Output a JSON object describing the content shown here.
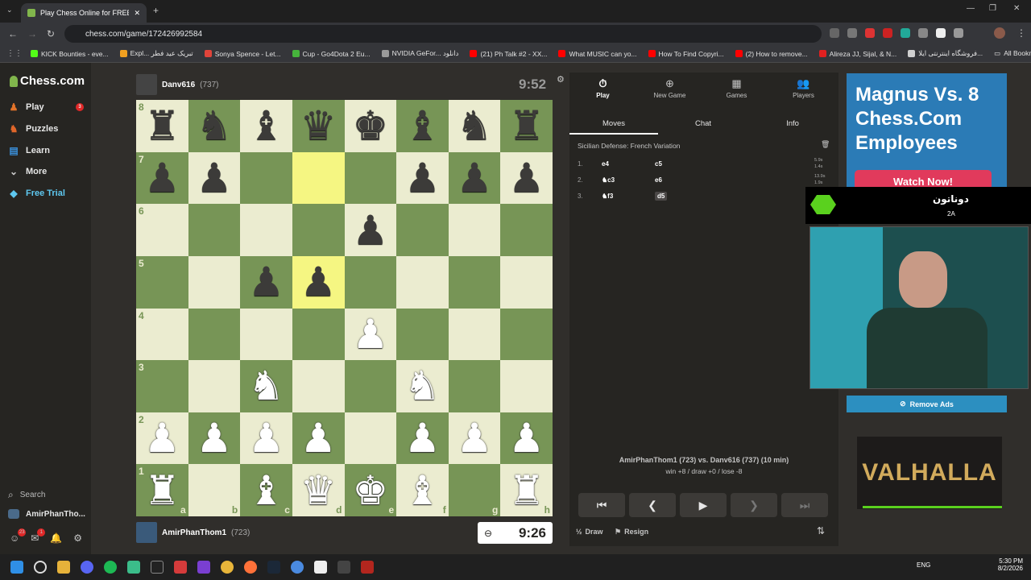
{
  "browser": {
    "tab_title": "Play Chess Online for FREE",
    "tab_close": "✕",
    "new_tab": "+",
    "url": "chess.com/game/172426992584",
    "bookmarks": [
      {
        "label": "KICK Bounties - eve...",
        "color": "#53fc18"
      },
      {
        "label": "Expl... تبریک عید فطر",
        "color": "#f0a020"
      },
      {
        "label": "Sonya Spence - Let...",
        "color": "#e0443a"
      },
      {
        "label": "Cup - Go4Dota 2 Eu...",
        "color": "#46b43c"
      },
      {
        "label": "NVIDIA GeFor... دانلود",
        "color": "#9a9a9a"
      },
      {
        "label": "(21) Ph Talk #2 - XX...",
        "color": "#ff0000"
      },
      {
        "label": "What MUSIC can yo...",
        "color": "#ff0000"
      },
      {
        "label": "How To Find Copyri...",
        "color": "#ff0000"
      },
      {
        "label": "(2) How to remove...",
        "color": "#ff0000"
      },
      {
        "label": "Alireza JJ, Sijal, & N...",
        "color": "#e02020"
      },
      {
        "label": "فروشگاه اینترنتی ایلا...",
        "color": "#d0d0d0"
      }
    ],
    "all_bookmarks": "All Bookmarks"
  },
  "sidebar": {
    "logo": "Chess.com",
    "items": [
      {
        "label": "Play",
        "color": "#e27329",
        "badge": "3"
      },
      {
        "label": "Puzzles",
        "color": "#e0662a",
        "badge": ""
      },
      {
        "label": "Learn",
        "color": "#3a8fd9",
        "badge": ""
      },
      {
        "label": "More",
        "color": "",
        "badge": ""
      },
      {
        "label": "Free Trial",
        "color": "#5ec8f0",
        "badge": ""
      }
    ],
    "search": "Search",
    "user": "AmirPhanTho...",
    "friends_badge": "23",
    "messages_badge": "1"
  },
  "game": {
    "top_player": {
      "name": "Danv616",
      "rating": "(737)",
      "clock": "9:52"
    },
    "bottom_player": {
      "name": "AmirPhanThom1",
      "rating": "(723)",
      "clock": "9:26"
    },
    "ranks": [
      "8",
      "7",
      "6",
      "5",
      "4",
      "3",
      "2",
      "1"
    ],
    "files": [
      "a",
      "b",
      "c",
      "d",
      "e",
      "f",
      "g",
      "h"
    ],
    "position": [
      "rnbqkbnr",
      "pp...ppp",
      "....p...",
      "..pp....",
      "....P...",
      "..N..N..",
      "PPPP.PPP",
      "R.BQKB.R"
    ],
    "highlight": [
      "d7",
      "d5"
    ]
  },
  "panel": {
    "tabs": [
      {
        "label": "Play",
        "icon": "⏱"
      },
      {
        "label": "New Game",
        "icon": "⊕"
      },
      {
        "label": "Games",
        "icon": "▦"
      },
      {
        "label": "Players",
        "icon": "👥"
      }
    ],
    "subtabs": [
      "Moves",
      "Chat",
      "Info"
    ],
    "opening": "Sicilian Defense: French Variation",
    "moves": [
      {
        "n": "1.",
        "w": "e4",
        "b": "c5"
      },
      {
        "n": "2.",
        "w": "♞c3",
        "b": "e6"
      },
      {
        "n": "3.",
        "w": "♞f3",
        "b": "d5"
      }
    ],
    "times": [
      {
        "w": "5.9s",
        "b": "1.4s"
      },
      {
        "w": "13.9s",
        "b": "1.9s"
      }
    ],
    "matchup": "AmirPhanThom1 (723) vs. Danv616 (737) (10 min)",
    "record": "win +8 / draw +0 / lose -8",
    "draw": "Draw",
    "draw_icon": "½",
    "resign": "Resign"
  },
  "ads": {
    "title": "Magnus Vs. 8 Chess.Com Employees",
    "cta": "Watch Now!",
    "remove_ads": "Remove Ads",
    "valhalla": "VALHALLA"
  },
  "stream": {
    "donation_name": "دوناتون",
    "donation_amount": "2A"
  },
  "taskbar": {
    "lang": "ENG",
    "time": "5:30 PM",
    "date": "8/2/2026"
  }
}
